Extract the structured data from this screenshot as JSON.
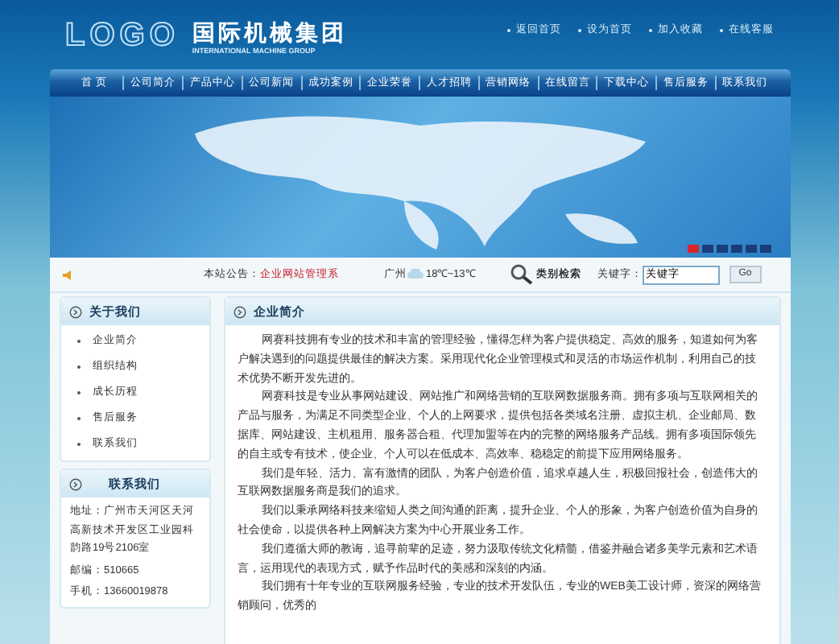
{
  "header": {
    "logo": "LOGO",
    "company": "国际机械集团",
    "company_en": "INTERNATIONAL MACHINE GROUP",
    "links": [
      "返回首页",
      "设为首页",
      "加入收藏",
      "在线客服"
    ]
  },
  "nav": [
    "首 页",
    "公司简介",
    "产品中心",
    "公司新闻",
    "成功案例",
    "企业荣誉",
    "人才招聘",
    "营销网络",
    "在线留言",
    "下载中心",
    "售后服务",
    "联系我们"
  ],
  "banner": {
    "slides": [
      {
        "selected": true
      },
      {
        "selected": false
      },
      {
        "selected": false
      },
      {
        "selected": false
      },
      {
        "selected": false
      },
      {
        "selected": false
      }
    ]
  },
  "notice": {
    "label": "本站公告：",
    "text": "企业网站管理系",
    "city": "广州",
    "temperature": "18℃~13℃",
    "search_title": "类别检索",
    "keyword_label": "关键字：",
    "keyword_value": "关键字",
    "go": "Go"
  },
  "sidebar": {
    "about_title": "关于我们",
    "items": [
      "企业简介",
      "组织结构",
      "成长历程",
      "售后服务",
      "联系我们"
    ],
    "contact_title": "联系我们",
    "contact": [
      "地址：广州市天河区天河高新技术开发区工业园科韵路19号2106室",
      "邮编：510665",
      "手机：13660019878"
    ]
  },
  "content": {
    "title": "企业简介",
    "paragraphs": [
      "网赛科技拥有专业的技术和丰富的管理经验，懂得怎样为客户提供稳定、高效的服务，知道如何为客户解决遇到的问题提供最佳的解决方案。采用现代化企业管理模式和灵活的市场运作机制，利用自己的技术优势不断开发先进的。",
      "网赛科技是专业从事网站建设、网站推广和网络营销的互联网数据服务商。拥有多项与互联网相关的产品与服务，为满足不同类型企业、个人的上网要求，提供包括各类域名注册、虚拟主机、企业邮局、数据库、网站建设、主机租用、服务器合租、代理加盟等在内的完整的网络服务产品线。拥有多项国际领先的自主或专有技术，使企业、个人可以在低成本、高效率、稳稳定的前提下应用网络服务。",
      "我们是年轻、活力、富有激情的团队，为客户创造价值，追求卓越人生，积极回报社会，创造伟大的互联网数据服务商是我们的追求。",
      "我们以秉承网络科技来缩短人类之间沟通的距离，提升企业、个人的形象，为客户创造价值为自身的社会使命，以提供各种上网解决方案为中心开展业务工作。",
      "我们遵循大师的教诲，追寻前辈的足迹，努力汲取传统文化精髓，借鉴并融合诸多美学元素和艺术语言，运用现代的表现方式，赋予作品时代的美感和深刻的内涵。",
      "我们拥有十年专业的互联网服务经验，专业的技术开发队伍，专业的WEB美工设计师，资深的网络营销顾问，优秀的"
    ]
  }
}
